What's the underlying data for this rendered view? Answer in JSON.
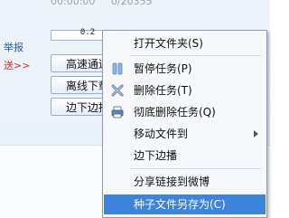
{
  "task": {
    "meta_left": "00:00:00",
    "meta_right": "0/20355",
    "report_link": "举报",
    "send_link": "送>>",
    "progress_text": "0.2",
    "buttons": {
      "fast": "高速通道",
      "offline": "离线下载",
      "stream": "边下边播"
    }
  },
  "menu": {
    "items": [
      {
        "label": "打开文件夹(S)",
        "icon": ""
      },
      {
        "label": "暂停任务(P)",
        "icon": "pause-icon"
      },
      {
        "label": "删除任务(T)",
        "icon": "delete-x-icon"
      },
      {
        "label": "彻底删除任务(Q)",
        "icon": "printer-icon"
      },
      {
        "label": "移动文件到",
        "icon": "",
        "submenu": true
      },
      {
        "label": "边下边播",
        "icon": ""
      },
      {
        "label": "分享链接到微博",
        "icon": ""
      },
      {
        "label": "种子文件另存为(C)",
        "icon": "",
        "selected": true
      }
    ]
  },
  "colors": {
    "selected_bg": "#3f84dc",
    "link_blue": "#1a5db7",
    "link_red": "#d0302a"
  }
}
